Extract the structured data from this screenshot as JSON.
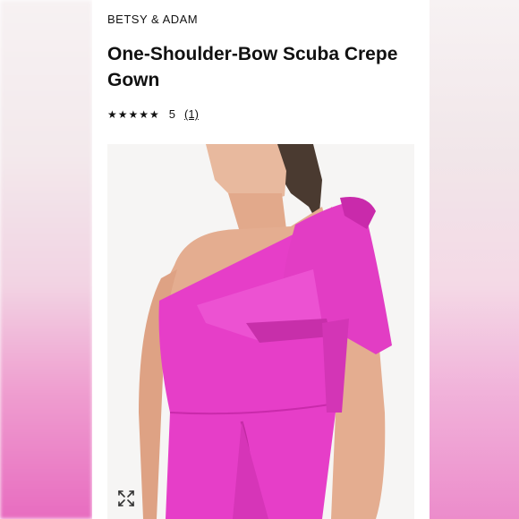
{
  "product": {
    "brand": "BETSY & ADAM",
    "title": "One-Shoulder-Bow Scuba Crepe Gown",
    "stars": "★★★★★",
    "rating": "5",
    "review_count": "(1)"
  },
  "image": {
    "alt": "Model wearing a pink one-shoulder bow scuba crepe gown",
    "zoom_icon": "expand-arrows-icon"
  },
  "colors": {
    "dress": "#e63ec8",
    "background": "#ffffff",
    "text": "#111111"
  }
}
